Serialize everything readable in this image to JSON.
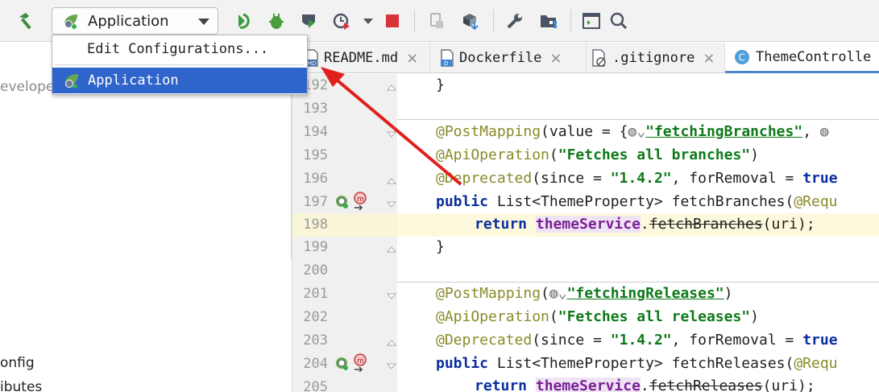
{
  "toolbar": {
    "run_config_label": "Application",
    "icons": [
      "hammer-icon",
      "rerun-icon",
      "debug-icon",
      "coverage-icon",
      "profile-icon",
      "stop-icon",
      "attach-icon",
      "build-icon",
      "settings-icon",
      "project-structure-icon",
      "terminal-icon",
      "search-icon"
    ]
  },
  "popup": {
    "edit_label": "Edit Configurations...",
    "app_label": "Application"
  },
  "left_panel": {
    "items": [
      "evelope",
      "onfig",
      "ibutes"
    ]
  },
  "tabs": [
    {
      "label": "README.md",
      "icon": "markdown-icon"
    },
    {
      "label": "Dockerfile",
      "icon": "docker-icon"
    },
    {
      "label": ".gitignore",
      "icon": "gitignore-icon"
    },
    {
      "label": "ThemeControlle",
      "icon": "class-icon"
    }
  ],
  "colors": {
    "selection": "#2f65ca",
    "arrow": "#e0201c",
    "highlight_line": "#fdf9dd"
  },
  "editor": {
    "lines": [
      {
        "n": "192",
        "code": "}"
      },
      {
        "n": "193",
        "code": ""
      },
      {
        "n": "194",
        "code": "@PostMapping(value = {\"fetchingBranches\", "
      },
      {
        "n": "195",
        "code": "@ApiOperation(\"Fetches all branches\")"
      },
      {
        "n": "196",
        "code": "@Deprecated(since = \"1.4.2\", forRemoval = true"
      },
      {
        "n": "197",
        "code": "public List<ThemeProperty> fetchBranches(@Requ"
      },
      {
        "n": "198",
        "code": "    return themeService.fetchBranches(uri);"
      },
      {
        "n": "199",
        "code": "}"
      },
      {
        "n": "200",
        "code": ""
      },
      {
        "n": "201",
        "code": "@PostMapping(\"fetchingReleases\")"
      },
      {
        "n": "202",
        "code": "@ApiOperation(\"Fetches all releases\")"
      },
      {
        "n": "203",
        "code": "@Deprecated(since = \"1.4.2\", forRemoval = true"
      },
      {
        "n": "204",
        "code": "public List<ThemeProperty> fetchReleases(@Requ"
      },
      {
        "n": "205",
        "code": "    return themeService.fetchReleases(uri);"
      }
    ],
    "tokens": {
      "l194": {
        "a": "@PostMapping",
        "b": "(value = {",
        "c": "\"fetchingBranches\"",
        "d": ", "
      },
      "l195": {
        "a": "@ApiOperation",
        "b": "(",
        "c": "\"Fetches all branches\"",
        "d": ")"
      },
      "l196": {
        "a": "@Deprecated",
        "b": "(since = ",
        "c": "\"1.4.2\"",
        "d": ", forRemoval = ",
        "e": "true"
      },
      "l197": {
        "a": "public",
        "b": " List<ThemeProperty> fetchBranches(",
        "c": "@Requ"
      },
      "l198": {
        "a": "return",
        "b": "themeService",
        "c": ".",
        "d": "fetchBranches",
        "e": "(uri);"
      },
      "l201": {
        "a": "@PostMapping",
        "b": "(",
        "c": "\"fetchingReleases\"",
        "d": ")"
      },
      "l202": {
        "a": "@ApiOperation",
        "b": "(",
        "c": "\"Fetches all releases\"",
        "d": ")"
      },
      "l203": {
        "a": "@Deprecated",
        "b": "(since = ",
        "c": "\"1.4.2\"",
        "d": ", forRemoval = ",
        "e": "true"
      },
      "l204": {
        "a": "public",
        "b": " List<ThemeProperty> fetchReleases(",
        "c": "@Requ"
      },
      "l205": {
        "a": "return",
        "b": "themeService",
        "c": ".",
        "d": "fetchReleases",
        "e": "(uri);"
      }
    }
  }
}
